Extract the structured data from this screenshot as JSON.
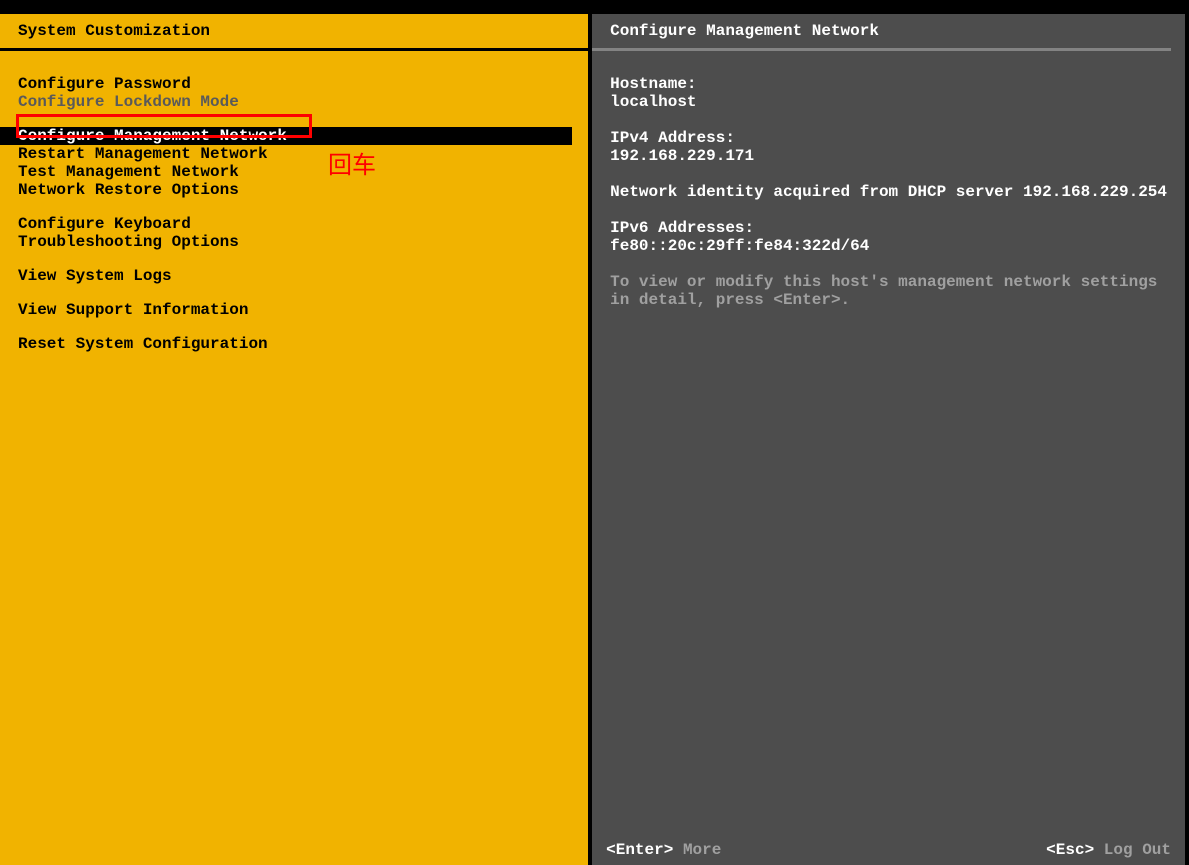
{
  "left": {
    "title": "System Customization",
    "groups": [
      [
        {
          "label": "Configure Password",
          "state": "normal"
        },
        {
          "label": "Configure Lockdown Mode",
          "state": "disabled"
        }
      ],
      [
        {
          "label": "Configure Management Network",
          "state": "selected"
        },
        {
          "label": "Restart Management Network",
          "state": "normal"
        },
        {
          "label": "Test Management Network",
          "state": "normal"
        },
        {
          "label": "Network Restore Options",
          "state": "normal"
        }
      ],
      [
        {
          "label": "Configure Keyboard",
          "state": "normal"
        },
        {
          "label": "Troubleshooting Options",
          "state": "normal"
        }
      ],
      [
        {
          "label": "View System Logs",
          "state": "normal"
        }
      ],
      [
        {
          "label": "View Support Information",
          "state": "normal"
        }
      ],
      [
        {
          "label": "Reset System Configuration",
          "state": "normal"
        }
      ]
    ],
    "annotation": "回车"
  },
  "right": {
    "title": "Configure Management Network",
    "hostname_label": "Hostname:",
    "hostname": "localhost",
    "ipv4_label": "IPv4 Address:",
    "ipv4": "192.168.229.171",
    "dhcp_line": "Network identity acquired from DHCP server 192.168.229.254",
    "ipv6_label": "IPv6 Addresses:",
    "ipv6": "fe80::20c:29ff:fe84:322d/64",
    "hint": "To view or modify this host's management network settings in detail, press <Enter>."
  },
  "footer": {
    "left_key": "<Enter>",
    "left_action": "More",
    "right_key": "<Esc>",
    "right_action": "Log Out"
  }
}
